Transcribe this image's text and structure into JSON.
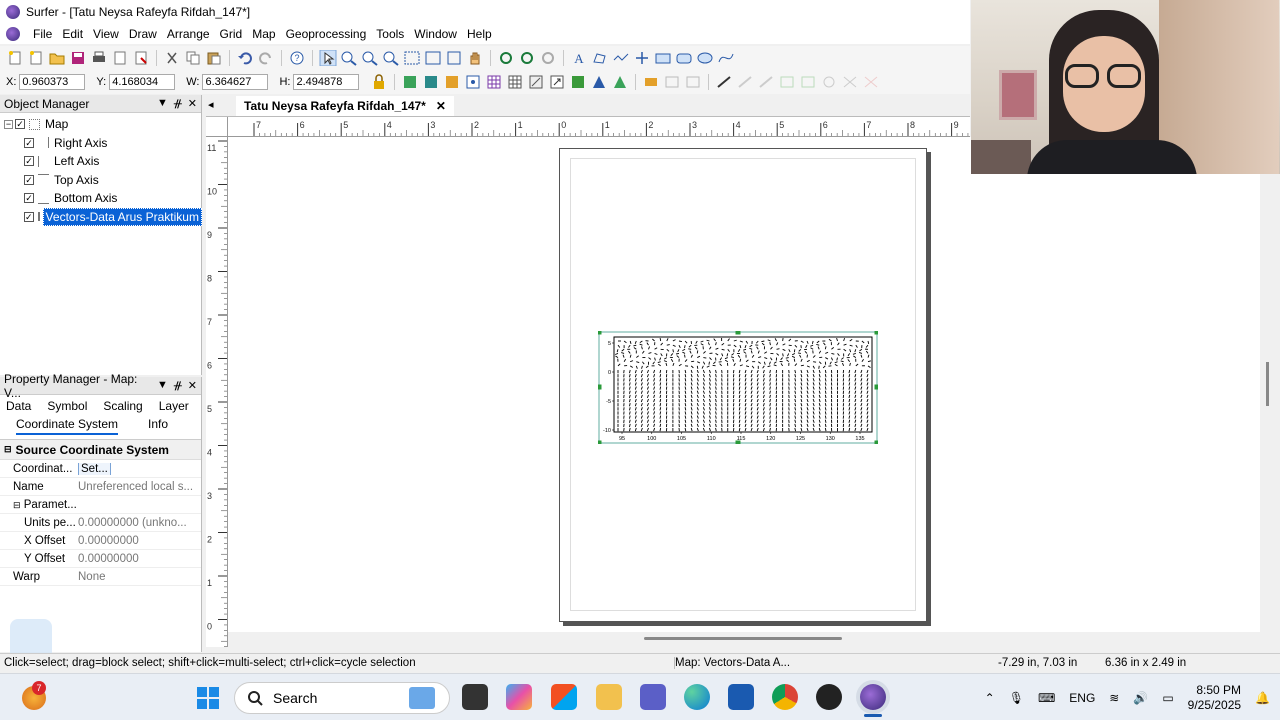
{
  "window": {
    "title": "Surfer - [Tatu Neysa Rafeyfa Rifdah_147*]"
  },
  "menu": [
    "File",
    "Edit",
    "View",
    "Draw",
    "Arrange",
    "Grid",
    "Map",
    "Geoprocessing",
    "Tools",
    "Window",
    "Help"
  ],
  "coords": {
    "x_label": "X:",
    "x": "0.960373",
    "y_label": "Y:",
    "y": "4.168034",
    "w_label": "W:",
    "w": "6.364627",
    "h_label": "H:",
    "h": "2.494878"
  },
  "object_manager": {
    "title": "Object Manager",
    "items": [
      {
        "label": "Map"
      },
      {
        "label": "Right Axis"
      },
      {
        "label": "Left Axis"
      },
      {
        "label": "Top Axis"
      },
      {
        "label": "Bottom Axis"
      },
      {
        "label": "Vectors-Data Arus Praktikum"
      }
    ]
  },
  "property_manager": {
    "title": "Property Manager - Map: V...",
    "tabs_row1": [
      "Data",
      "Symbol",
      "Scaling",
      "Layer"
    ],
    "tabs_row2": [
      "Coordinate System",
      "Info"
    ],
    "section": "Source Coordinate System",
    "rows": [
      {
        "key": "Coordinat...",
        "value": "Set..."
      },
      {
        "key": "Name",
        "value": "Unreferenced local s..."
      },
      {
        "key": "Paramet...",
        "value": ""
      },
      {
        "key": "Units pe...",
        "value": "0.00000000 (unkno..."
      },
      {
        "key": "X Offset",
        "value": "0.00000000"
      },
      {
        "key": "Y Offset",
        "value": "0.00000000"
      },
      {
        "key": "Warp",
        "value": "None"
      }
    ]
  },
  "document_tab": "Tatu Neysa Rafeyfa Rifdah_147*",
  "rulers": {
    "h_labels": [
      "7",
      "6",
      "5",
      "4",
      "3",
      "2",
      "1",
      "0",
      "1",
      "2",
      "3",
      "4",
      "5",
      "6",
      "7",
      "8",
      "9"
    ],
    "v_labels": [
      "11",
      "10",
      "9",
      "8",
      "7",
      "6",
      "5",
      "4",
      "3",
      "2",
      "1",
      "0"
    ]
  },
  "plot": {
    "x_ticks": [
      "95",
      "100",
      "105",
      "110",
      "115",
      "120",
      "125",
      "130",
      "135"
    ],
    "y_ticks": [
      "5",
      "0",
      "-5",
      "-10"
    ]
  },
  "status": {
    "hint": "Click=select; drag=block select; shift+click=multi-select; ctrl+click=cycle selection",
    "object": "Map: Vectors-Data A...",
    "position": "-7.29 in, 7.03 in",
    "size": "6.36 in x 2.49 in"
  },
  "taskbar": {
    "search_placeholder": "Search",
    "lang": "ENG",
    "time": "8:50 PM",
    "date": "9/25/2025",
    "notif_badge": "7"
  }
}
